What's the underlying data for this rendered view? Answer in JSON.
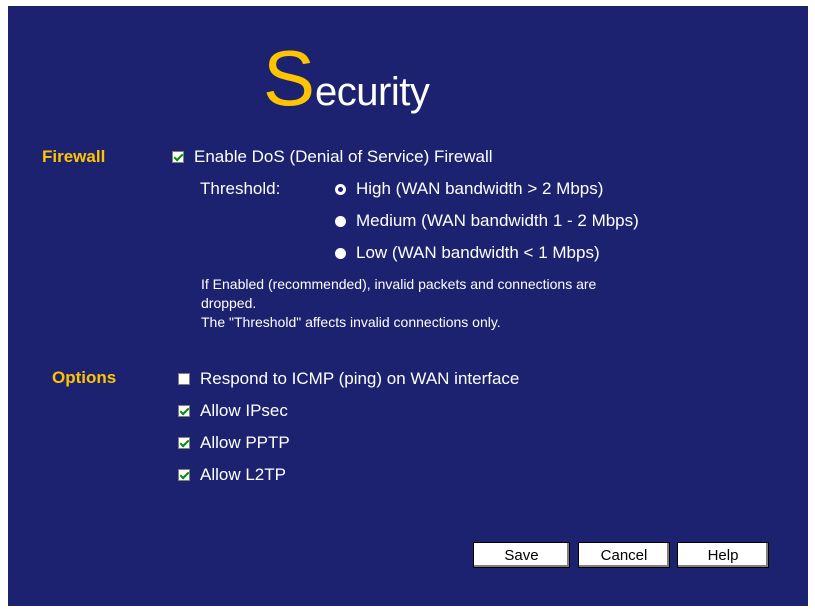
{
  "page": {
    "title_initial": "S",
    "title_rest": "ecurity"
  },
  "firewall": {
    "section_label": "Firewall",
    "enable_dos": {
      "label": "Enable DoS (Denial of Service) Firewall",
      "checked": true
    },
    "threshold_label": "Threshold:",
    "threshold_options": [
      {
        "label": "High (WAN bandwidth > 2 Mbps)",
        "selected": true
      },
      {
        "label": "Medium (WAN bandwidth 1 - 2 Mbps)",
        "selected": false
      },
      {
        "label": "Low (WAN bandwidth < 1 Mbps)",
        "selected": false
      }
    ],
    "note_line1": "If Enabled (recommended), invalid packets and connections are",
    "note_line2": "dropped.",
    "note_line3": "The \"Threshold\" affects invalid connections only."
  },
  "options": {
    "section_label": "Options",
    "items": [
      {
        "label": "Respond to ICMP (ping) on WAN interface",
        "checked": false
      },
      {
        "label": "Allow IPsec",
        "checked": true
      },
      {
        "label": "Allow PPTP",
        "checked": true
      },
      {
        "label": "Allow L2TP",
        "checked": true
      }
    ]
  },
  "buttons": {
    "save": "Save",
    "cancel": "Cancel",
    "help": "Help"
  },
  "colors": {
    "background": "#1c2270",
    "accent": "#ffc400",
    "text": "#ffffff"
  }
}
